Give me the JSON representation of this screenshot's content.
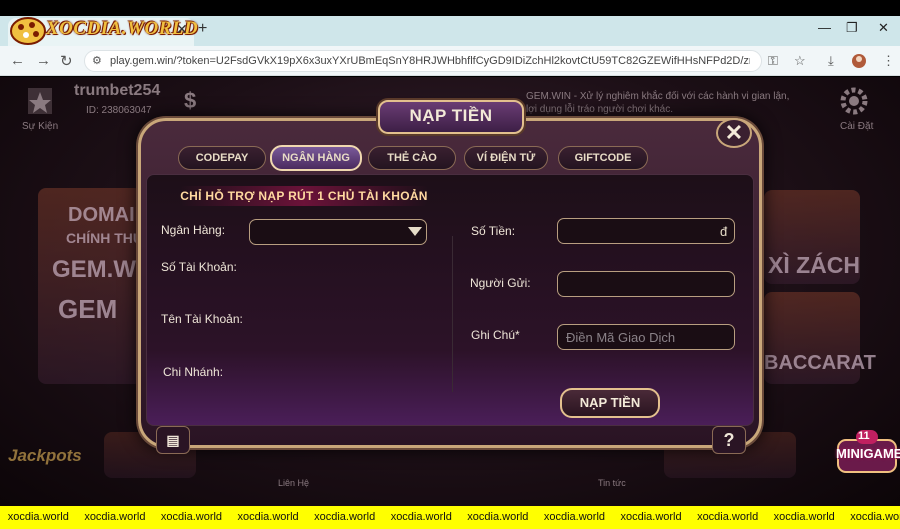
{
  "browser": {
    "tab_title": "XOCDIA.WORLD",
    "url": "play.gem.win/?token=U2FsdGVkX19pX6x3uxYXrUBmEqSnY8HRJWHbhflfCyGD9IDiZchHl2kovtCtU59TC82GZEWifHHsNFPd2D/zrpNW8NiKa1MoG4jX..."
  },
  "game": {
    "username": "trumbet254",
    "user_id": "ID: 238063047",
    "left_icon_label": "Sự Kiện",
    "right_icon_label": "Cài Đặt",
    "marquee": "GEM.WIN - Xử lý nghiêm khắc đối với các hành vi gian lận, lợi dụng lỗi tráo người chơi khác.",
    "left_card_lines": [
      "DOMAIN",
      "CHÍNH THỨC",
      "GEM.WIN",
      "GEM"
    ],
    "right_cards": [
      "XÌ ZÁCH",
      "BACCARAT"
    ],
    "bottom_labels": [
      "Jackpots",
      "Liên Hệ",
      "Tin tức"
    ],
    "minigame": {
      "count": "11",
      "label": "MINIGAME"
    }
  },
  "modal": {
    "title": "NẠP TIỀN",
    "tabs": [
      {
        "label": "CODEPAY"
      },
      {
        "label": "NGÂN HÀNG",
        "active": true
      },
      {
        "label": "THẺ CÀO"
      },
      {
        "label": "VÍ ĐIỆN TỬ"
      },
      {
        "label": "GIFTCODE"
      }
    ],
    "notice": "CHỈ HỖ TRỢ NẠP RÚT 1 CHỦ TÀI KHOẢN",
    "left_fields": {
      "bank_label": "Ngân Hàng:",
      "account_number_label": "Số Tài Khoản:",
      "account_name_label": "Tên Tài Khoản:",
      "branch_label": "Chi Nhánh:"
    },
    "right_fields": {
      "amount_label": "Số Tiền:",
      "currency": "đ",
      "sender_label": "Người Gửi:",
      "note_label": "Ghi Chú*",
      "note_placeholder": "Điền Mã Giao Dịch"
    },
    "submit_label": "NẠP TIỀN"
  },
  "ticker": [
    "xocdia.world",
    "xocdia.world",
    "xocdia.world",
    "xocdia.world",
    "xocdia.world",
    "xocdia.world",
    "xocdia.world",
    "xocdia.world",
    "xocdia.world",
    "xocdia.world",
    "xocdia.world",
    "xocdia.world"
  ],
  "colors": {
    "accent_gold": "#c9a77a",
    "ticker_bg": "#ffff00",
    "active_tab": "#7a5a9a"
  }
}
